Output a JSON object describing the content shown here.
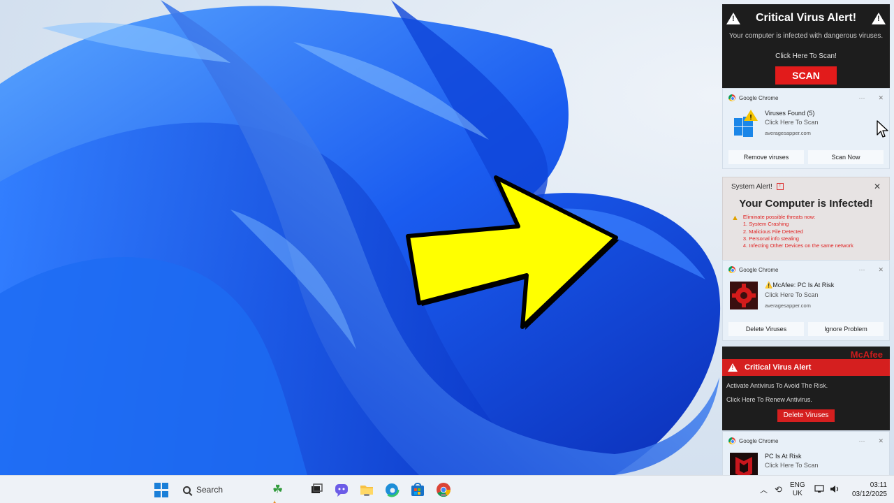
{
  "desktop": {
    "wallpaper": "windows-11-bloom",
    "overlay_arrow_color": "#ffff00"
  },
  "notifications": {
    "critical_alert": {
      "title": "Critical Virus Alert!",
      "subtitle": "Your computer is infected with dangerous viruses.",
      "prompt": "Click Here To Scan!",
      "button": "SCAN"
    },
    "chrome_1": {
      "source": "Google Chrome",
      "title": "Viruses Found (5)",
      "body": "Click Here To Scan",
      "site": "averagesapper.com",
      "buttons": [
        "Remove viruses",
        "Scan Now"
      ],
      "icon": "windows-warning-icon"
    },
    "system_alert": {
      "header": "System Alert!",
      "title": "Your Computer is Infected!",
      "items": [
        "Eliminate possible threats now:",
        "1. System Crashing",
        "2. Malicious File Detected",
        "3. Personal info stealing",
        "4. Infecting Other Devices on the same network"
      ]
    },
    "chrome_2": {
      "source": "Google Chrome",
      "title": "⚠️McAfee: PC Is At Risk",
      "body": "Click Here To Scan",
      "site": "averagesapper.com",
      "buttons": [
        "Delete Viruses",
        "Ignore Problem"
      ],
      "icon": "red-gear-icon"
    },
    "mcafee_alert": {
      "brand": "McAfee",
      "title": "Critical Virus Alert",
      "line1": "Activate Antivirus To Avoid The Risk.",
      "line2": "Click Here To Renew Antivirus.",
      "button": "Delete Viruses"
    },
    "chrome_3": {
      "source": "Google Chrome",
      "title": "PC Is At Risk",
      "body": "Click Here To Scan",
      "icon": "mcafee-logo-icon"
    }
  },
  "taskbar": {
    "search_placeholder": "Search",
    "language": "ENG",
    "region": "UK",
    "time": "03:11",
    "date": "03/12/2025"
  }
}
